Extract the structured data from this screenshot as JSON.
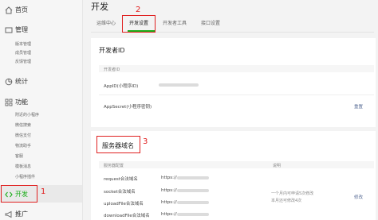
{
  "sidebar": {
    "home": "首页",
    "manage": "管理",
    "manage_subs": [
      "版本管理",
      "成员管理",
      "反馈管理"
    ],
    "stats": "统计",
    "features": "功能",
    "features_subs": [
      "附近的小程序",
      "微信搜索",
      "微信支付",
      "物流助手",
      "客服",
      "模板消息",
      "小程序插件"
    ],
    "dev": "开发",
    "promo": "推广"
  },
  "main": {
    "title": "开发",
    "tabs": [
      "运维中心",
      "开发设置",
      "开发者工具",
      "接口设置"
    ]
  },
  "dev_id": {
    "title": "开发者ID",
    "header": "开发者ID",
    "appid_label": "AppID(小程序ID)",
    "appsecret_label": "AppSecret(小程序密钥)",
    "reset_link": "重置"
  },
  "server_domain": {
    "title": "服务器域名",
    "col_config": "服务器配置",
    "col_desc": "说明",
    "rows": [
      {
        "label": "request合法域名",
        "prefix": "https://"
      },
      {
        "label": "socket合法域名",
        "prefix": "https://"
      },
      {
        "label": "uploadFile合法域名",
        "prefix": "https://"
      },
      {
        "label": "downloadFile合法域名",
        "prefix": "https://"
      }
    ],
    "desc_line1": "一个月内可申请5次修改",
    "desc_line2": "本月还可修改4次",
    "modify_link": "修改"
  },
  "annotations": [
    "1",
    "2",
    "3"
  ],
  "colors": {
    "annotation": "#e02020",
    "accent": "#1aad19",
    "link": "#576b95"
  }
}
